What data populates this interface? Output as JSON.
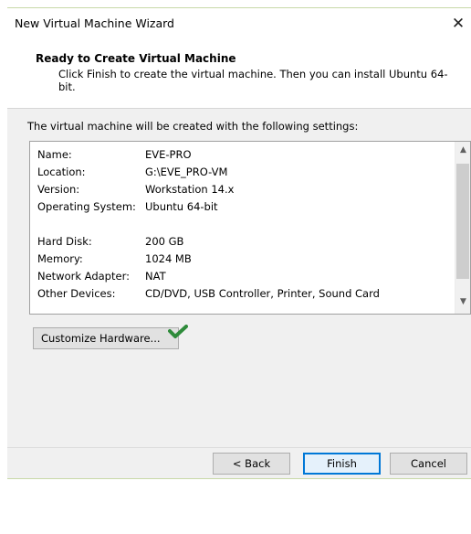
{
  "window": {
    "title": "New Virtual Machine Wizard",
    "close_glyph": "✕"
  },
  "header": {
    "title": "Ready to Create Virtual Machine",
    "description": "Click Finish to create the virtual machine. Then you can install Ubuntu 64-bit."
  },
  "intro": "The virtual machine will be created with the following settings:",
  "settings": [
    {
      "key": "Name:",
      "value": "EVE-PRO"
    },
    {
      "key": "Location:",
      "value": "G:\\EVE_PRO-VM"
    },
    {
      "key": "Version:",
      "value": "Workstation 14.x"
    },
    {
      "key": "Operating System:",
      "value": "Ubuntu 64-bit"
    },
    {
      "key": "",
      "value": ""
    },
    {
      "key": "Hard Disk:",
      "value": "200 GB"
    },
    {
      "key": "Memory:",
      "value": "1024 MB"
    },
    {
      "key": "Network Adapter:",
      "value": "NAT"
    },
    {
      "key": "Other Devices:",
      "value": "CD/DVD, USB Controller, Printer, Sound Card"
    }
  ],
  "buttons": {
    "customize": "Customize Hardware...",
    "back": "< Back",
    "finish": "Finish",
    "cancel": "Cancel"
  },
  "colors": {
    "check": "#2e8b3a",
    "focus_border": "#0078d7"
  },
  "icons": {
    "close": "close-icon",
    "scroll_up": "chevron-up-icon",
    "scroll_down": "chevron-down-icon",
    "check": "check-icon"
  }
}
